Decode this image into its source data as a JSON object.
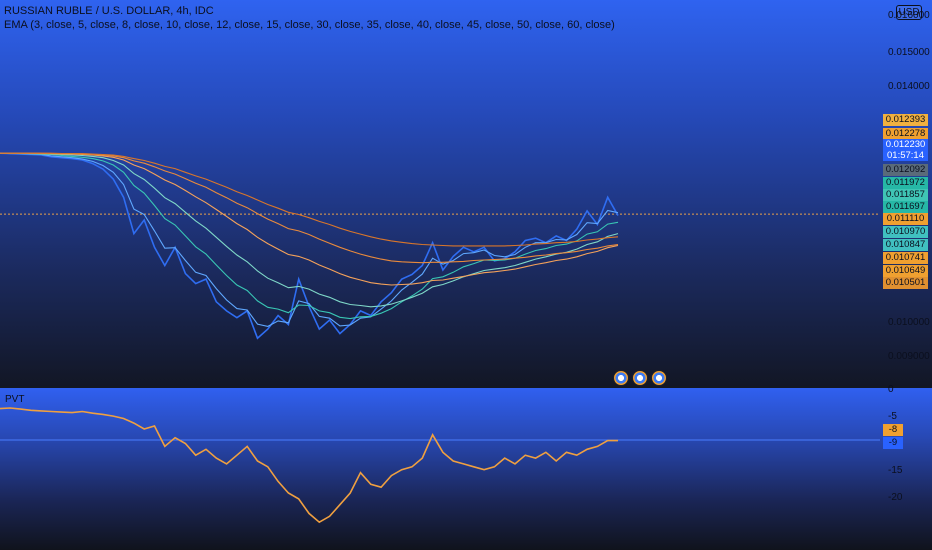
{
  "header": {
    "symbol_title": "RUSSIAN RUBLE / U.S. DOLLAR, 4h, IDC",
    "indicator_title": "EMA (3, close, 5, close, 8, close, 10, close, 12, close, 15, close, 30, close, 35, close, 40, close, 45, close, 50, close, 60, close)",
    "currency": "USD"
  },
  "pvt_title": "PVT",
  "price_axis": {
    "labels": [
      "0.016000",
      "0.015000",
      "0.014000",
      "0.010000",
      "0.009000"
    ]
  },
  "price_badges": [
    {
      "value": "0.012393",
      "color": "#f0b040"
    },
    {
      "value": "0.012278",
      "color": "#f0a030"
    },
    {
      "value": "0.012230",
      "color": "#2962ff",
      "countdown": "01:57:14"
    },
    {
      "value": "0.012092",
      "color": "#5a6b7a"
    },
    {
      "value": "0.011972",
      "color": "#26b8a6"
    },
    {
      "value": "0.011857",
      "color": "#3fc5b5"
    },
    {
      "value": "0.011697",
      "color": "#26b8a6"
    },
    {
      "value": "0.011110",
      "color": "#f0a030"
    },
    {
      "value": "0.010970",
      "color": "#40c0c0"
    },
    {
      "value": "0.010847",
      "color": "#40c0c0"
    },
    {
      "value": "0.010741",
      "color": "#f0a030"
    },
    {
      "value": "0.010649",
      "color": "#f0a030"
    },
    {
      "value": "0.010501",
      "color": "#e09030"
    }
  ],
  "pvt_axis": {
    "labels": [
      "0",
      "-5",
      "-15",
      "-20"
    ],
    "badges": [
      {
        "value": "-8",
        "color": "#f0a030"
      },
      {
        "value": "-9",
        "color": "#2962ff"
      }
    ]
  },
  "chart_data": [
    {
      "type": "line",
      "title": "RUSSIAN RUBLE / U.S. DOLLAR, 4h, IDC",
      "ylim": [
        0.0088,
        0.0165
      ],
      "last_price": 0.01223,
      "series": [
        {
          "name": "RUB/USD",
          "color": "#2f6df2",
          "values": [
            0.01357,
            0.01356,
            0.01355,
            0.01354,
            0.01353,
            0.01349,
            0.01347,
            0.01345,
            0.01342,
            0.01334,
            0.01322,
            0.013,
            0.0126,
            0.0118,
            0.0121,
            0.0115,
            0.0111,
            0.0115,
            0.01092,
            0.0107,
            0.0108,
            0.0103,
            0.0101,
            0.00995,
            0.0101,
            0.0095,
            0.0097,
            0.01,
            0.0098,
            0.0108,
            0.0102,
            0.0097,
            0.0099,
            0.0096,
            0.0098,
            0.0101,
            0.01,
            0.0103,
            0.0105,
            0.0108,
            0.0109,
            0.0111,
            0.0116,
            0.011,
            0.0113,
            0.0115,
            0.0114,
            0.0115,
            0.0112,
            0.01125,
            0.0114,
            0.01165,
            0.0117,
            0.0116,
            0.01175,
            0.01165,
            0.0119,
            0.0123,
            0.012,
            0.0126,
            0.0122
          ]
        },
        {
          "name": "EMA 3",
          "color": "#5fa8ff",
          "values": [
            0.01357,
            0.01356,
            0.01356,
            0.01355,
            0.01354,
            0.01351,
            0.01349,
            0.01347,
            0.01344,
            0.01339,
            0.0133,
            0.01315,
            0.01288,
            0.01234,
            0.01222,
            0.01186,
            0.01148,
            0.01149,
            0.01121,
            0.01095,
            0.01088,
            0.01059,
            0.01034,
            0.01015,
            0.01012,
            0.00981,
            0.00976,
            0.00988,
            0.00984,
            0.01032,
            0.01026,
            0.00998,
            0.00994,
            0.00977,
            0.00979,
            0.00994,
            0.00997,
            0.01014,
            0.01032,
            0.01056,
            0.01073,
            0.01091,
            0.01126,
            0.01113,
            0.01121,
            0.01136,
            0.01138,
            0.01144,
            0.01132,
            0.01129,
            0.01134,
            0.0115,
            0.0116,
            0.0116,
            0.01167,
            0.01166,
            0.01178,
            0.01204,
            0.01202,
            0.01231,
            0.01226
          ]
        },
        {
          "name": "EMA 8",
          "color": "#39c6b4",
          "values": [
            0.01357,
            0.01357,
            0.01356,
            0.01356,
            0.01355,
            0.01354,
            0.01352,
            0.0135,
            0.01348,
            0.01345,
            0.0134,
            0.01331,
            0.01315,
            0.01286,
            0.01269,
            0.01242,
            0.01213,
            0.01199,
            0.01175,
            0.01151,
            0.01135,
            0.01111,
            0.01088,
            0.01067,
            0.01055,
            0.01032,
            0.01018,
            0.01014,
            0.01006,
            0.01023,
            0.01022,
            0.0101,
            0.01006,
            0.00996,
            0.00993,
            0.00997,
            0.00998,
            0.01005,
            0.01015,
            0.0103,
            0.01043,
            0.01058,
            0.01081,
            0.01085,
            0.01095,
            0.01107,
            0.01114,
            0.01122,
            0.01121,
            0.01122,
            0.01126,
            0.01135,
            0.01143,
            0.01147,
            0.01154,
            0.01157,
            0.01164,
            0.01179,
            0.01184,
            0.01201,
            0.01205
          ]
        },
        {
          "name": "EMA 15",
          "color": "#7fd8c8",
          "values": [
            0.01357,
            0.01357,
            0.01357,
            0.01356,
            0.01356,
            0.01355,
            0.01354,
            0.01353,
            0.01352,
            0.0135,
            0.01347,
            0.01341,
            0.01331,
            0.01312,
            0.01299,
            0.0128,
            0.01259,
            0.01246,
            0.01227,
            0.01208,
            0.01192,
            0.01172,
            0.01152,
            0.01133,
            0.01118,
            0.01098,
            0.01082,
            0.01072,
            0.01061,
            0.01064,
            0.01058,
            0.01047,
            0.0104,
            0.0103,
            0.01024,
            0.01022,
            0.01019,
            0.01021,
            0.01025,
            0.01032,
            0.0104,
            0.01049,
            0.01063,
            0.01068,
            0.01076,
            0.01085,
            0.01092,
            0.01099,
            0.01102,
            0.01105,
            0.0111,
            0.01117,
            0.01124,
            0.01129,
            0.01135,
            0.01139,
            0.01146,
            0.01156,
            0.01162,
            0.01174,
            0.0118
          ]
        },
        {
          "name": "EMA 30",
          "color": "#f5a25a",
          "values": [
            0.01357,
            0.01357,
            0.01357,
            0.01357,
            0.01356,
            0.01356,
            0.01355,
            0.01355,
            0.01354,
            0.01353,
            0.01351,
            0.01348,
            0.01342,
            0.01331,
            0.01323,
            0.01311,
            0.01298,
            0.01288,
            0.01275,
            0.01261,
            0.01248,
            0.01233,
            0.01218,
            0.01202,
            0.01189,
            0.01172,
            0.01158,
            0.01146,
            0.01134,
            0.0113,
            0.01122,
            0.01111,
            0.01102,
            0.01092,
            0.01084,
            0.01078,
            0.01072,
            0.01069,
            0.01067,
            0.01068,
            0.01069,
            0.01072,
            0.01077,
            0.01078,
            0.01082,
            0.01086,
            0.0109,
            0.01094,
            0.01096,
            0.01099,
            0.01102,
            0.01107,
            0.01112,
            0.01116,
            0.01121,
            0.01124,
            0.01129,
            0.01136,
            0.01141,
            0.01149,
            0.01154
          ]
        },
        {
          "name": "EMA 45",
          "color": "#e98a3c",
          "values": [
            0.01357,
            0.01357,
            0.01357,
            0.01357,
            0.01357,
            0.01356,
            0.01356,
            0.01356,
            0.01355,
            0.01354,
            0.01353,
            0.01351,
            0.01347,
            0.0134,
            0.01335,
            0.01327,
            0.01318,
            0.01311,
            0.01301,
            0.01291,
            0.01282,
            0.0127,
            0.01259,
            0.01247,
            0.01237,
            0.01224,
            0.01212,
            0.01202,
            0.01191,
            0.01186,
            0.01178,
            0.01168,
            0.01159,
            0.0115,
            0.01142,
            0.01135,
            0.01129,
            0.01124,
            0.0112,
            0.01118,
            0.01117,
            0.01116,
            0.01117,
            0.01117,
            0.01118,
            0.01119,
            0.01121,
            0.01122,
            0.01123,
            0.01124,
            0.01126,
            0.01128,
            0.01131,
            0.01133,
            0.01136,
            0.01138,
            0.01141,
            0.01145,
            0.01148,
            0.01153,
            0.01156
          ]
        },
        {
          "name": "EMA 60",
          "color": "#d9762a",
          "values": [
            0.01357,
            0.01357,
            0.01357,
            0.01357,
            0.01357,
            0.01357,
            0.01356,
            0.01356,
            0.01356,
            0.01355,
            0.01354,
            0.01353,
            0.0135,
            0.01345,
            0.01341,
            0.01335,
            0.01328,
            0.01323,
            0.01315,
            0.01307,
            0.013,
            0.01291,
            0.01282,
            0.01272,
            0.01264,
            0.01254,
            0.01244,
            0.01236,
            0.01227,
            0.01222,
            0.01215,
            0.01207,
            0.012,
            0.01192,
            0.01185,
            0.01179,
            0.01173,
            0.01168,
            0.01164,
            0.01161,
            0.01158,
            0.01156,
            0.01155,
            0.01154,
            0.01153,
            0.01153,
            0.01153,
            0.01153,
            0.01153,
            0.01153,
            0.01154,
            0.01155,
            0.01157,
            0.01158,
            0.0116,
            0.01161,
            0.01163,
            0.01166,
            0.01168,
            0.01171,
            0.01173
          ]
        }
      ]
    },
    {
      "type": "line",
      "title": "PVT",
      "ylim": [
        -23,
        0
      ],
      "series": [
        {
          "name": "PVT",
          "color": "#f0a040",
          "values": [
            -2.5,
            -2.4,
            -2.6,
            -2.8,
            -2.9,
            -3.0,
            -3.1,
            -3.2,
            -3.0,
            -3.3,
            -3.5,
            -3.8,
            -4.2,
            -5.0,
            -6.0,
            -5.5,
            -9.0,
            -7.5,
            -8.5,
            -10.5,
            -9.5,
            -11.0,
            -12.0,
            -10.5,
            -9.0,
            -11.5,
            -12.5,
            -15.0,
            -17.0,
            -18.0,
            -20.5,
            -22.0,
            -21.0,
            -19.0,
            -17.0,
            -13.5,
            -15.5,
            -16.0,
            -14.0,
            -13.0,
            -12.5,
            -11.0,
            -7.0,
            -10.0,
            -11.5,
            -12.0,
            -12.5,
            -13.0,
            -12.5,
            -11.0,
            -12.0,
            -10.5,
            -11.0,
            -10.0,
            -11.5,
            -10.0,
            -10.5,
            -9.5,
            -9.0,
            -8.0,
            -8.0
          ]
        }
      ]
    }
  ]
}
